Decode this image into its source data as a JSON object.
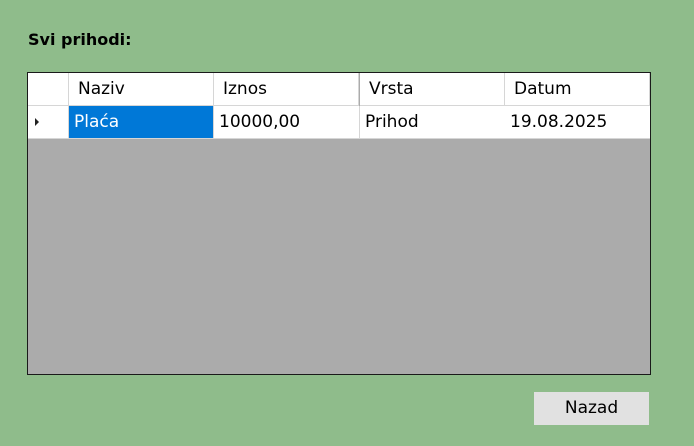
{
  "window": {
    "background": "#8fbc8b",
    "title_label": "Svi prihodi:"
  },
  "grid": {
    "background": "#ababab",
    "selection_color": "#0078d7",
    "columns": [
      "Naziv",
      "Iznos",
      "Vrsta",
      "Datum"
    ],
    "rows": [
      {
        "current": true,
        "row_indicator_icon": "current-row-arrow-icon",
        "cells": [
          "Plaća",
          "10000,00",
          "Prihod",
          "19.08.2025"
        ]
      }
    ]
  },
  "buttons": {
    "back_label": "Nazad"
  }
}
